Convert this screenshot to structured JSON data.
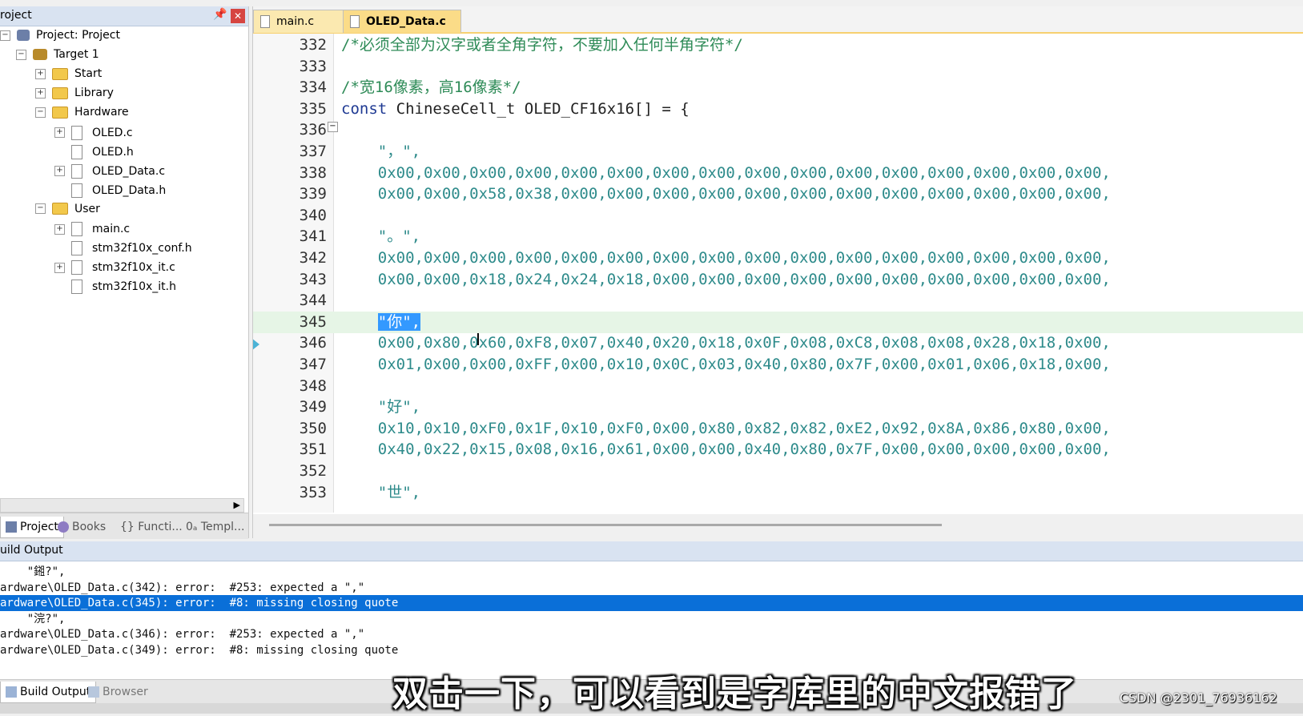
{
  "project_panel": {
    "title": "roject",
    "pin_icon": "pin-icon",
    "close_symbol": "✕",
    "tree": [
      {
        "label": "Project: Project",
        "icon": "project-icon",
        "level": 0,
        "expander": "-"
      },
      {
        "label": "Target 1",
        "icon": "target-icon",
        "level": 1,
        "expander": "-"
      },
      {
        "label": "Start",
        "icon": "folder-icon",
        "level": 2,
        "expander": "+"
      },
      {
        "label": "Library",
        "icon": "folder-icon",
        "level": 2,
        "expander": "+"
      },
      {
        "label": "Hardware",
        "icon": "folder-icon",
        "level": 2,
        "expander": "-"
      },
      {
        "label": "OLED.c",
        "icon": "file-icon",
        "level": 3,
        "expander": "+"
      },
      {
        "label": "OLED.h",
        "icon": "file-icon",
        "level": 3,
        "expander": ""
      },
      {
        "label": "OLED_Data.c",
        "icon": "file-icon",
        "level": 3,
        "expander": "+"
      },
      {
        "label": "OLED_Data.h",
        "icon": "file-icon",
        "level": 3,
        "expander": ""
      },
      {
        "label": "User",
        "icon": "folder-icon",
        "level": 2,
        "expander": "-"
      },
      {
        "label": "main.c",
        "icon": "file-icon",
        "level": 3,
        "expander": "+"
      },
      {
        "label": "stm32f10x_conf.h",
        "icon": "file-icon",
        "level": 3,
        "expander": ""
      },
      {
        "label": "stm32f10x_it.c",
        "icon": "file-icon",
        "level": 3,
        "expander": "+"
      },
      {
        "label": "stm32f10x_it.h",
        "icon": "file-icon",
        "level": 3,
        "expander": ""
      }
    ],
    "tabs": [
      "Project",
      "Books",
      "{} Functi...",
      "0ₐ Templ..."
    ]
  },
  "editor": {
    "tabs": [
      {
        "label": "main.c",
        "active": false
      },
      {
        "label": "OLED_Data.c",
        "active": true
      }
    ],
    "lines": [
      {
        "n": "332",
        "text": "/*必须全部为汉字或者全角字符，不要加入任何半角字符*/",
        "kind": "comment"
      },
      {
        "n": "333",
        "text": "",
        "kind": "plain"
      },
      {
        "n": "334",
        "text": "/*宽16像素，高16像素*/",
        "kind": "comment"
      },
      {
        "n": "335",
        "text": "const ChineseCell_t OLED_CF16x16[] = {",
        "kind": "decl"
      },
      {
        "n": "336",
        "text": "",
        "kind": "plain"
      },
      {
        "n": "337",
        "text": "    \"，\",",
        "kind": "str"
      },
      {
        "n": "338",
        "text": "    0x00,0x00,0x00,0x00,0x00,0x00,0x00,0x00,0x00,0x00,0x00,0x00,0x00,0x00,0x00,0x00,",
        "kind": "hex"
      },
      {
        "n": "339",
        "text": "    0x00,0x00,0x58,0x38,0x00,0x00,0x00,0x00,0x00,0x00,0x00,0x00,0x00,0x00,0x00,0x00,",
        "kind": "hex"
      },
      {
        "n": "340",
        "text": "",
        "kind": "plain"
      },
      {
        "n": "341",
        "text": "    \"。\",",
        "kind": "str"
      },
      {
        "n": "342",
        "text": "    0x00,0x00,0x00,0x00,0x00,0x00,0x00,0x00,0x00,0x00,0x00,0x00,0x00,0x00,0x00,0x00,",
        "kind": "hex"
      },
      {
        "n": "343",
        "text": "    0x00,0x00,0x18,0x24,0x24,0x18,0x00,0x00,0x00,0x00,0x00,0x00,0x00,0x00,0x00,0x00,",
        "kind": "hex"
      },
      {
        "n": "344",
        "text": "",
        "kind": "plain"
      },
      {
        "n": "345",
        "text": "\"你\",",
        "kind": "selected"
      },
      {
        "n": "346",
        "text": "    0x00,0x80,0x60,0xF8,0x07,0x40,0x20,0x18,0x0F,0x08,0xC8,0x08,0x08,0x28,0x18,0x00,",
        "kind": "hex"
      },
      {
        "n": "347",
        "text": "    0x01,0x00,0x00,0xFF,0x00,0x10,0x0C,0x03,0x40,0x80,0x7F,0x00,0x01,0x06,0x18,0x00,",
        "kind": "hex"
      },
      {
        "n": "348",
        "text": "",
        "kind": "plain"
      },
      {
        "n": "349",
        "text": "    \"好\",",
        "kind": "str"
      },
      {
        "n": "350",
        "text": "    0x10,0x10,0xF0,0x1F,0x10,0xF0,0x00,0x80,0x82,0x82,0xE2,0x92,0x8A,0x86,0x80,0x00,",
        "kind": "hex"
      },
      {
        "n": "351",
        "text": "    0x40,0x22,0x15,0x08,0x16,0x61,0x00,0x00,0x40,0x80,0x7F,0x00,0x00,0x00,0x00,0x00,",
        "kind": "hex"
      },
      {
        "n": "352",
        "text": "",
        "kind": "plain"
      },
      {
        "n": "353",
        "text": "    \"世\",",
        "kind": "str"
      }
    ],
    "current_line": "345",
    "selected_text": "\"你\","
  },
  "build_output": {
    "title": "uild Output",
    "lines": [
      {
        "text": "    \"鎺?\",",
        "selected": false
      },
      {
        "text": "ardware\\OLED_Data.c(342): error:  #253: expected a \",\"",
        "selected": false
      },
      {
        "text": "ardware\\OLED_Data.c(345): error:  #8: missing closing quote",
        "selected": true
      },
      {
        "text": "    \"浣?\",",
        "selected": false
      },
      {
        "text": "ardware\\OLED_Data.c(346): error:  #253: expected a \",\"",
        "selected": false
      },
      {
        "text": "ardware\\OLED_Data.c(349): error:  #8: missing closing quote",
        "selected": false
      }
    ],
    "tabs": [
      "Build Output",
      "Browser"
    ]
  },
  "overlay": {
    "subtitle": "双击一下，可以看到是字库里的中文报错了",
    "watermark": "CSDN @2301_76936162"
  },
  "colors": {
    "selection_blue": "#0a6fd8",
    "comment_green": "#2e8b57",
    "hex_teal": "#2e8b8b",
    "active_tab": "#fbdc88"
  }
}
